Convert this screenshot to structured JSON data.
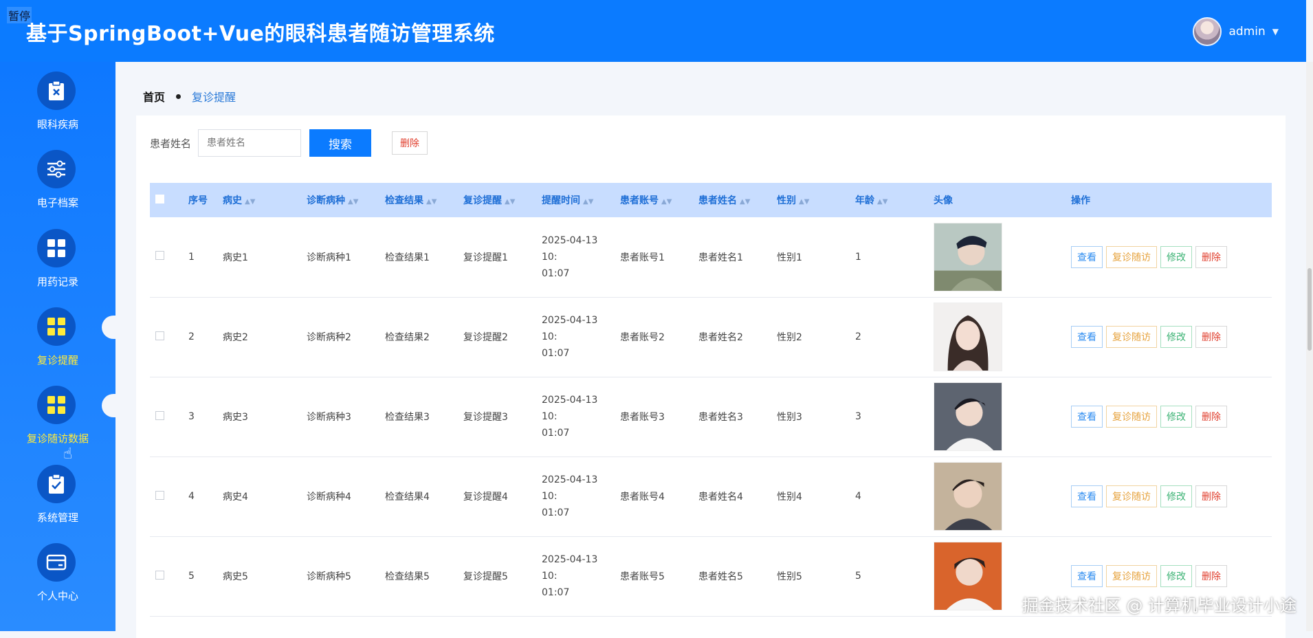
{
  "status_overlay": "暂停",
  "header": {
    "title": "基于SpringBoot+Vue的眼科患者随访管理系统",
    "user_name": "admin"
  },
  "sidebar": {
    "items": [
      {
        "label": "眼科疾病",
        "icon": "clipboard-x-icon"
      },
      {
        "label": "电子档案",
        "icon": "sliders-icon"
      },
      {
        "label": "用药记录",
        "icon": "grid-icon"
      },
      {
        "label": "复诊提醒",
        "icon": "grid-icon",
        "active": true
      },
      {
        "label": "复诊随访数据",
        "icon": "grid-icon",
        "active": true
      },
      {
        "label": "系统管理",
        "icon": "clipboard-check-icon"
      },
      {
        "label": "个人中心",
        "icon": "card-icon"
      }
    ]
  },
  "breadcrumb": {
    "home": "首页",
    "current": "复诊提醒"
  },
  "search": {
    "label": "患者姓名",
    "placeholder": "患者姓名",
    "search_button": "搜索",
    "delete_button": "删除"
  },
  "table": {
    "headers": [
      "序号",
      "病史",
      "诊断病种",
      "检查结果",
      "复诊提醒",
      "提醒时间",
      "患者账号",
      "患者姓名",
      "性别",
      "年龄",
      "头像",
      "操作"
    ],
    "rows": [
      {
        "no": "1",
        "history": "病史1",
        "disease": "诊断病种1",
        "result": "检查结果1",
        "reminder": "复诊提醒1",
        "time1": "2025-04-13 10:",
        "time2": "01:07",
        "account": "患者账号1",
        "name": "患者姓名1",
        "gender": "性别1",
        "age": "1"
      },
      {
        "no": "2",
        "history": "病史2",
        "disease": "诊断病种2",
        "result": "检查结果2",
        "reminder": "复诊提醒2",
        "time1": "2025-04-13 10:",
        "time2": "01:07",
        "account": "患者账号2",
        "name": "患者姓名2",
        "gender": "性别2",
        "age": "2"
      },
      {
        "no": "3",
        "history": "病史3",
        "disease": "诊断病种3",
        "result": "检查结果3",
        "reminder": "复诊提醒3",
        "time1": "2025-04-13 10:",
        "time2": "01:07",
        "account": "患者账号3",
        "name": "患者姓名3",
        "gender": "性别3",
        "age": "3"
      },
      {
        "no": "4",
        "history": "病史4",
        "disease": "诊断病种4",
        "result": "检查结果4",
        "reminder": "复诊提醒4",
        "time1": "2025-04-13 10:",
        "time2": "01:07",
        "account": "患者账号4",
        "name": "患者姓名4",
        "gender": "性别4",
        "age": "4"
      },
      {
        "no": "5",
        "history": "病史5",
        "disease": "诊断病种5",
        "result": "检查结果5",
        "reminder": "复诊提醒5",
        "time1": "2025-04-13 10:",
        "time2": "01:07",
        "account": "患者账号5",
        "name": "患者姓名5",
        "gender": "性别5",
        "age": "5"
      }
    ],
    "actions": {
      "view": "查看",
      "follow": "复诊随访",
      "edit": "修改",
      "delete": "删除"
    }
  },
  "watermark": "掘金技术社区 @ 计算机毕业设计小途",
  "colors": {
    "primary": "#0b7bff",
    "accent": "#ffeb3b",
    "danger": "#e03e2d",
    "warning": "#e6a23c",
    "success": "#3bb273"
  }
}
